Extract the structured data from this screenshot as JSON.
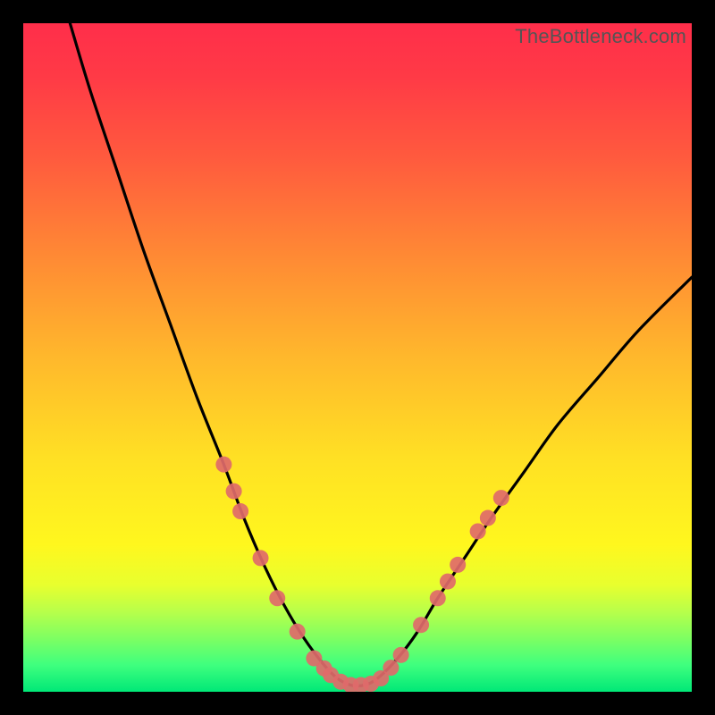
{
  "watermark": "TheBottleneck.com",
  "chart_data": {
    "type": "line",
    "title": "",
    "xlabel": "",
    "ylabel": "",
    "xlim": [
      0,
      100
    ],
    "ylim": [
      0,
      100
    ],
    "grid": false,
    "series": [
      {
        "name": "bottleneck-curve",
        "x": [
          7,
          10,
          14,
          18,
          22,
          26,
          30,
          33,
          36,
          39,
          42,
          45,
          47,
          49,
          51,
          53,
          56,
          59,
          62,
          66,
          70,
          75,
          80,
          86,
          92,
          100
        ],
        "y": [
          100,
          90,
          78,
          66,
          55,
          44,
          34,
          26,
          19,
          13,
          8,
          4,
          2,
          1,
          1,
          2,
          5,
          9,
          14,
          20,
          26,
          33,
          40,
          47,
          54,
          62
        ]
      }
    ],
    "markers": [
      {
        "name": "left-cluster",
        "color": "#e06a6a",
        "radius_px": 9,
        "points": [
          {
            "x": 30.0,
            "y": 34
          },
          {
            "x": 31.5,
            "y": 30
          },
          {
            "x": 32.5,
            "y": 27
          },
          {
            "x": 35.5,
            "y": 20
          },
          {
            "x": 38.0,
            "y": 14
          },
          {
            "x": 41.0,
            "y": 9
          },
          {
            "x": 43.5,
            "y": 5
          },
          {
            "x": 45.0,
            "y": 3.5
          },
          {
            "x": 46.0,
            "y": 2.5
          }
        ]
      },
      {
        "name": "bottom-cluster",
        "color": "#e06a6a",
        "radius_px": 9,
        "points": [
          {
            "x": 47.5,
            "y": 1.5
          },
          {
            "x": 49.0,
            "y": 1.0
          },
          {
            "x": 50.5,
            "y": 1.0
          },
          {
            "x": 52.0,
            "y": 1.2
          },
          {
            "x": 53.5,
            "y": 2.0
          }
        ]
      },
      {
        "name": "right-cluster",
        "color": "#e06a6a",
        "radius_px": 9,
        "points": [
          {
            "x": 55.0,
            "y": 3.6
          },
          {
            "x": 56.5,
            "y": 5.5
          },
          {
            "x": 59.5,
            "y": 10
          },
          {
            "x": 62.0,
            "y": 14
          },
          {
            "x": 63.5,
            "y": 16.5
          },
          {
            "x": 65.0,
            "y": 19
          },
          {
            "x": 68.0,
            "y": 24
          },
          {
            "x": 69.5,
            "y": 26
          },
          {
            "x": 71.5,
            "y": 29
          }
        ]
      }
    ]
  }
}
